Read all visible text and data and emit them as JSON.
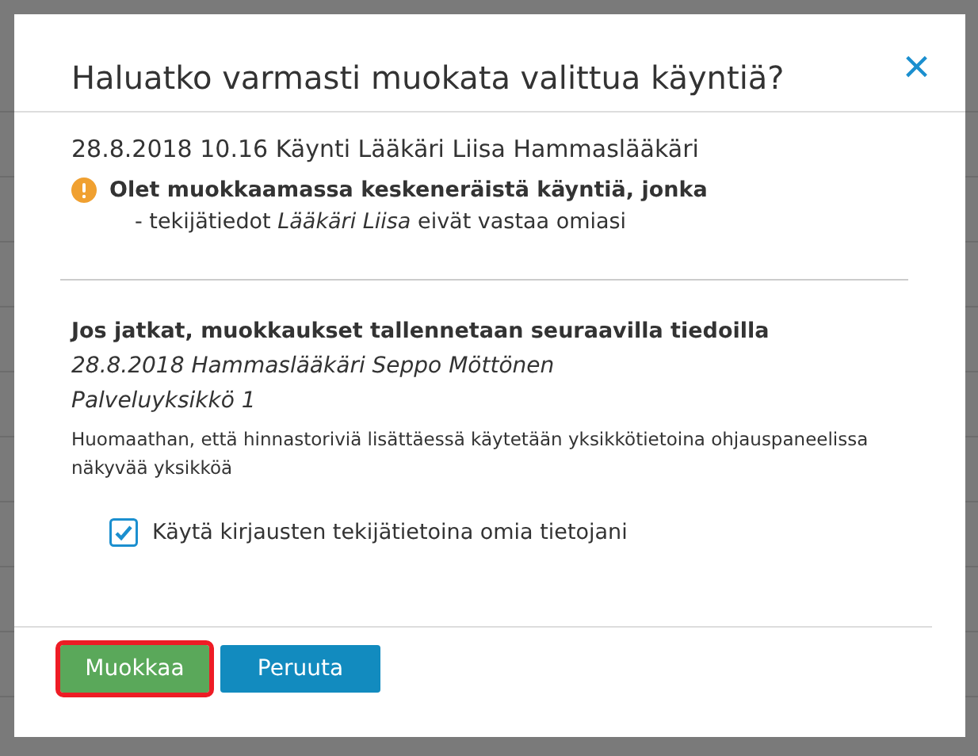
{
  "dialog": {
    "title": "Haluatko varmasti muokata valittua käyntiä?",
    "close": "×",
    "visit": "28.8.2018 10.16 Käynti Lääkäri Liisa Hammaslääkäri",
    "warning": {
      "title": "Olet muokkaamassa keskeneräistä käyntiä, jonka",
      "detail": "- tekijätiedot *Lääkäri Liisa* eivät vastaa omiasi"
    },
    "save_heading": "Jos jatkat, muokkaukset tallennetaan seuraavilla tiedoilla",
    "save_details": [
      "28.8.2018 Hammaslääkäri Seppo Möttönen",
      "Palveluyksikkö 1"
    ],
    "note": "Huomaathan, että hinnastoriviä lisättäessä käytetään yksikkötietoina ohjauspaneelissa näkyvää yksikköä",
    "checkbox": {
      "label": "Käytä kirjausten tekijätietoina omia tietojani",
      "checked": true
    },
    "buttons": [
      {
        "label": "Muokkaa",
        "kind": "primary",
        "highlighted": true
      },
      {
        "label": "Peruuta",
        "kind": "secondary",
        "highlighted": false
      }
    ]
  }
}
